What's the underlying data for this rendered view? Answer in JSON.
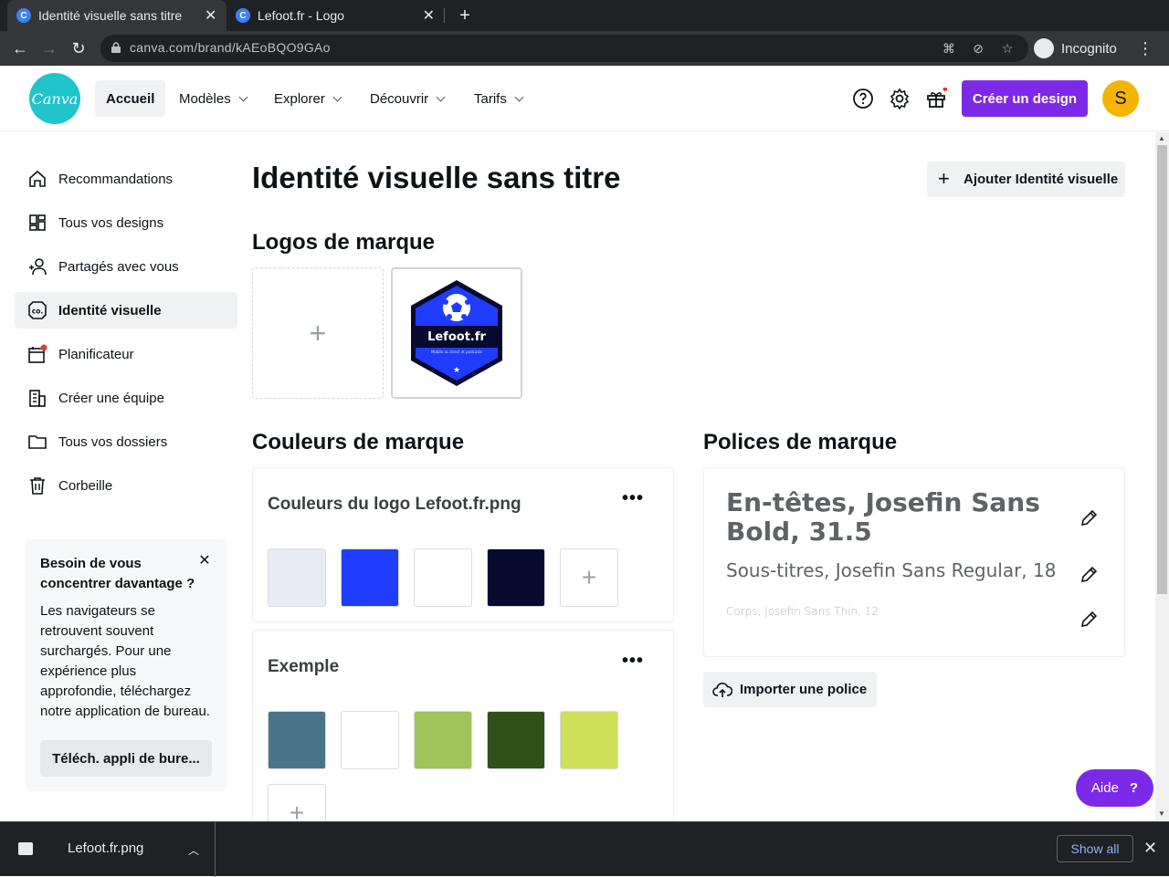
{
  "browser": {
    "tabs": [
      {
        "title": "Identité visuelle sans titre",
        "favicon": "C",
        "active": true
      },
      {
        "title": "Lefoot.fr - Logo",
        "favicon": "C",
        "active": false
      }
    ],
    "url": "canva.com/brand/kAEoBQO9GAo",
    "incognito_label": "Incognito"
  },
  "header": {
    "logo_text": "Canva",
    "nav": [
      {
        "label": "Accueil"
      },
      {
        "label": "Modèles"
      },
      {
        "label": "Explorer"
      },
      {
        "label": "Découvrir"
      },
      {
        "label": "Tarifs"
      }
    ],
    "create_button": "Créer un design",
    "avatar_initial": "S"
  },
  "sidebar": {
    "items": [
      {
        "label": "Recommandations",
        "icon": "home-icon"
      },
      {
        "label": "Tous vos designs",
        "icon": "grid-icon"
      },
      {
        "label": "Partagés avec vous",
        "icon": "users-icon"
      },
      {
        "label": "Identité visuelle",
        "icon": "brand-icon",
        "active": true
      },
      {
        "label": "Planificateur",
        "icon": "calendar-icon"
      },
      {
        "label": "Créer une équipe",
        "icon": "building-icon"
      },
      {
        "label": "Tous vos dossiers",
        "icon": "folder-icon"
      },
      {
        "label": "Corbeille",
        "icon": "trash-icon"
      }
    ],
    "promo": {
      "title": "Besoin de vous concentrer davantage ?",
      "body": "Les navigateurs se retrouvent souvent surchargés. Pour une expérience plus approfondie, téléchargez notre application de bureau.",
      "button": "Téléch. appli de bure..."
    }
  },
  "main": {
    "title": "Identité visuelle sans titre",
    "add_brand_button": "Ajouter Identité visuelle",
    "logos_title": "Logos de marque",
    "logo": {
      "name": "Lefoot.fr",
      "tagline": "Mobile as direct et podcasts"
    },
    "colors_title": "Couleurs de marque",
    "palettes": [
      {
        "name": "Couleurs du logo Lefoot.fr.png",
        "colors": [
          "#e8ebf4",
          "#1f3cff",
          "#ffffff",
          "#050a2e"
        ]
      },
      {
        "name": "Exemple",
        "colors": [
          "#4a7589",
          "#ffffff",
          "#9ec45a",
          "#2e5218",
          "#cfe05a"
        ]
      }
    ],
    "fonts_title": "Polices de marque",
    "fonts": {
      "heading": "En-têtes, Josefin Sans Bold, 31.5",
      "subheading": "Sous-titres, Josefin Sans Regular, 18",
      "body": "Corps, Josefin Sans Thin, 12"
    },
    "import_button": "Importer une police",
    "help_button": "Aide",
    "help_symbol": "?"
  },
  "downloads": {
    "file": "Lefoot.fr.png",
    "show_all": "Show all"
  },
  "colors": {
    "accent": "#7d2ae8",
    "canva_teal": "#20c4cb",
    "avatar": "#f5b400"
  }
}
